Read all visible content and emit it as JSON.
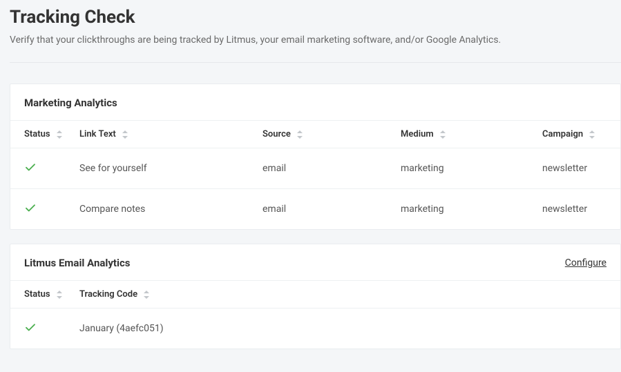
{
  "header": {
    "title": "Tracking Check",
    "subtitle": "Verify that your clickthroughs are being tracked by Litmus, your email marketing software, and/or Google Analytics."
  },
  "panels": {
    "marketing": {
      "title": "Marketing Analytics",
      "columns": {
        "status": "Status",
        "link_text": "Link Text",
        "source": "Source",
        "medium": "Medium",
        "campaign": "Campaign"
      },
      "rows": [
        {
          "status": "ok",
          "link_text": "See for yourself",
          "source": "email",
          "medium": "marketing",
          "campaign": "newsletter"
        },
        {
          "status": "ok",
          "link_text": "Compare notes",
          "source": "email",
          "medium": "marketing",
          "campaign": "newsletter"
        }
      ]
    },
    "litmus": {
      "title": "Litmus Email Analytics",
      "configure_label": "Configure",
      "columns": {
        "status": "Status",
        "tracking_code": "Tracking Code"
      },
      "rows": [
        {
          "status": "ok",
          "tracking_code": "January (4aefc051)"
        }
      ]
    }
  }
}
